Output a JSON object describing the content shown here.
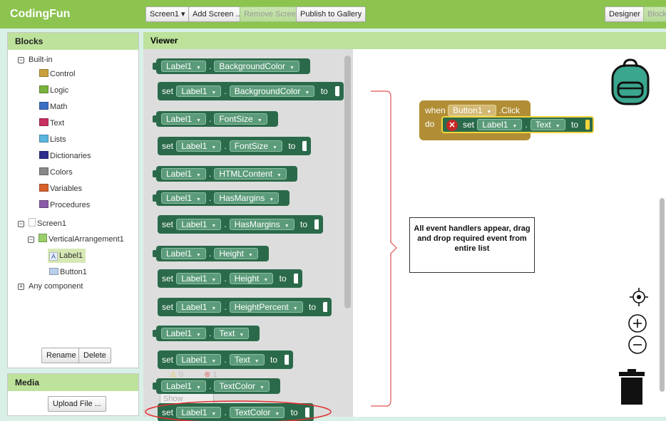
{
  "app": {
    "title": "CodingFun"
  },
  "toolbar": {
    "screen_select": "Screen1 ▾",
    "add_screen": "Add Screen ...",
    "remove_screen": "Remove Screen",
    "publish": "Publish to Gallery",
    "designer": "Designer",
    "blocks": "Blocks"
  },
  "blocks_panel": {
    "title": "Blocks",
    "builtin_label": "Built-in",
    "builtin": [
      {
        "label": "Control",
        "color": "#c9a13c"
      },
      {
        "label": "Logic",
        "color": "#78b33e"
      },
      {
        "label": "Math",
        "color": "#3b6fc4"
      },
      {
        "label": "Text",
        "color": "#c7305f"
      },
      {
        "label": "Lists",
        "color": "#5ab6e0"
      },
      {
        "label": "Dictionaries",
        "color": "#2d2d8c"
      },
      {
        "label": "Colors",
        "color": "#888888"
      },
      {
        "label": "Variables",
        "color": "#d8622b"
      },
      {
        "label": "Procedures",
        "color": "#8a5aa8"
      }
    ],
    "screen": "Screen1",
    "arrangement": "VerticalArrangement1",
    "label_item": "Label1",
    "button_item": "Button1",
    "any_component": "Any component",
    "rename": "Rename",
    "delete": "Delete"
  },
  "media_panel": {
    "title": "Media",
    "upload": "Upload File ..."
  },
  "viewer": {
    "title": "Viewer"
  },
  "flyout": {
    "component": "Label1",
    "set_word": "set",
    "to_word": "to",
    "blocks": [
      {
        "kind": "get",
        "prop": "BackgroundColor"
      },
      {
        "kind": "set",
        "prop": "BackgroundColor"
      },
      {
        "kind": "get",
        "prop": "FontSize"
      },
      {
        "kind": "set",
        "prop": "FontSize"
      },
      {
        "kind": "get",
        "prop": "HTMLContent"
      },
      {
        "kind": "get",
        "prop": "HasMargins"
      },
      {
        "kind": "set",
        "prop": "HasMargins"
      },
      {
        "kind": "get",
        "prop": "Height"
      },
      {
        "kind": "set",
        "prop": "Height"
      },
      {
        "kind": "set",
        "prop": "HeightPercent"
      },
      {
        "kind": "get",
        "prop": "Text"
      },
      {
        "kind": "set",
        "prop": "Text"
      },
      {
        "kind": "get",
        "prop": "TextColor"
      },
      {
        "kind": "set",
        "prop": "TextColor"
      }
    ]
  },
  "event_block": {
    "when": "when",
    "component": "Button1",
    "event": ".Click",
    "do": "do",
    "set": "set",
    "target": "Label1",
    "prop": "Text",
    "to": "to"
  },
  "annotation": {
    "text": "All event handlers appear, drag and drop required event from entire list"
  },
  "warnings": {
    "warn_count": "0",
    "error_count": "1",
    "show_warnings": "Show Warnings"
  }
}
